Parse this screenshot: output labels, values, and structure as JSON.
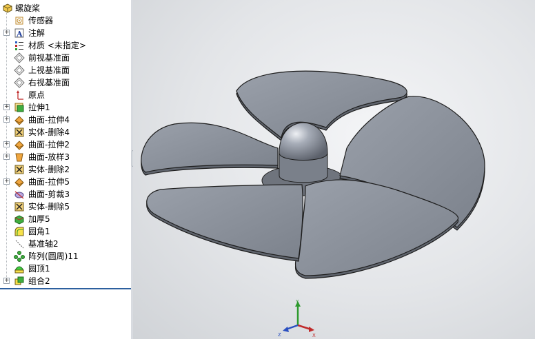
{
  "tree": {
    "root_label": "螺旋桨",
    "items": [
      {
        "label": "传感器",
        "icon": "sensor-icon",
        "expandable": false
      },
      {
        "label": "注解",
        "icon": "annotation-icon",
        "expandable": true
      },
      {
        "label": "材质 <未指定>",
        "icon": "material-icon",
        "expandable": false
      },
      {
        "label": "前视基准面",
        "icon": "plane-icon",
        "expandable": false
      },
      {
        "label": "上视基准面",
        "icon": "plane-icon",
        "expandable": false
      },
      {
        "label": "右视基准面",
        "icon": "plane-icon",
        "expandable": false
      },
      {
        "label": "原点",
        "icon": "origin-icon",
        "expandable": false
      },
      {
        "label": "拉伸1",
        "icon": "extrude-icon",
        "expandable": true
      },
      {
        "label": "曲面-拉伸4",
        "icon": "surface-extrude-icon",
        "expandable": true
      },
      {
        "label": "实体-删除4",
        "icon": "delete-body-icon",
        "expandable": false
      },
      {
        "label": "曲面-拉伸2",
        "icon": "surface-extrude-icon",
        "expandable": true
      },
      {
        "label": "曲面-放样3",
        "icon": "surface-loft-icon",
        "expandable": true
      },
      {
        "label": "实体-删除2",
        "icon": "delete-body-icon",
        "expandable": false
      },
      {
        "label": "曲面-拉伸5",
        "icon": "surface-extrude-icon",
        "expandable": true
      },
      {
        "label": "曲面-剪裁3",
        "icon": "surface-trim-icon",
        "expandable": false
      },
      {
        "label": "实体-删除5",
        "icon": "delete-body-icon",
        "expandable": false
      },
      {
        "label": "加厚5",
        "icon": "thicken-icon",
        "expandable": false
      },
      {
        "label": "圆角1",
        "icon": "fillet-icon",
        "expandable": false
      },
      {
        "label": "基准轴2",
        "icon": "axis-icon",
        "expandable": false
      },
      {
        "label": "阵列(圆周)11",
        "icon": "circular-pattern-icon",
        "expandable": false
      },
      {
        "label": "圆顶1",
        "icon": "dome-icon",
        "expandable": false
      },
      {
        "label": "组合2",
        "icon": "combine-icon",
        "expandable": true
      }
    ]
  },
  "triad": {
    "x": "X",
    "y": "Y",
    "z": "Z"
  },
  "colors": {
    "part": "#8e939c",
    "part_dark": "#5f646d",
    "background": "#e6e8eb"
  }
}
